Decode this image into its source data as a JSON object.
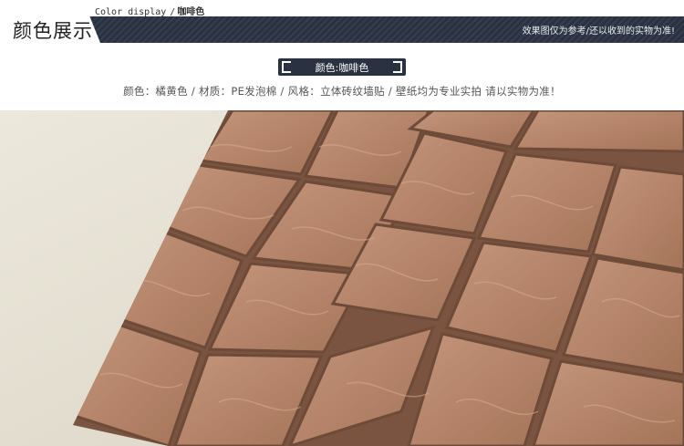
{
  "header": {
    "title": "颜色展示",
    "subtitle_en": "Color display",
    "subtitle_sep": "/",
    "subtitle_zh": "咖啡色",
    "disclaimer": "效果图仅为参考/还以收到的实物为准!"
  },
  "color_tag": {
    "label": "颜色:咖啡色"
  },
  "spec_line": "颜色：橘黄色 / 材质：PE发泡棉 / 风格：立体砖纹墙贴 / 壁纸均为专业实拍 请以实物为准！",
  "colors": {
    "banner_dark": "#2a3242",
    "brick": "#b8876c",
    "background_wall": "#e6e1d3"
  }
}
